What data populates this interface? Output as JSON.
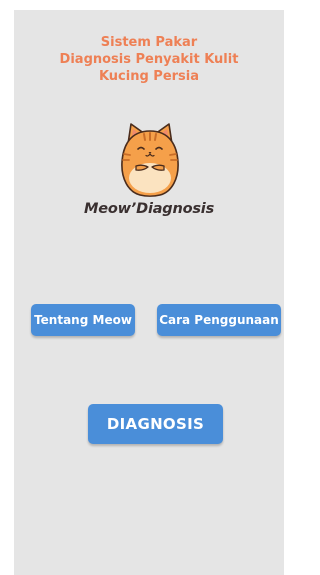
{
  "header": {
    "title_lines": [
      "Sistem Pakar",
      "Diagnosis Penyakit Kulit",
      "Kucing Persia"
    ]
  },
  "logo": {
    "icon": "orange-cat-icon",
    "brand_text": "Meow’Diagnosis"
  },
  "buttons": {
    "about_label": "Tentang Meow",
    "howto_label": "Cara Penggunaan",
    "diagnose_label": "DIAGNOSIS"
  },
  "colors": {
    "title": "#ee8055",
    "button": "#4a8ed9",
    "background": "#e5e5e5",
    "cat_orange": "#f5a04a",
    "cat_belly": "#fbe3c0"
  }
}
